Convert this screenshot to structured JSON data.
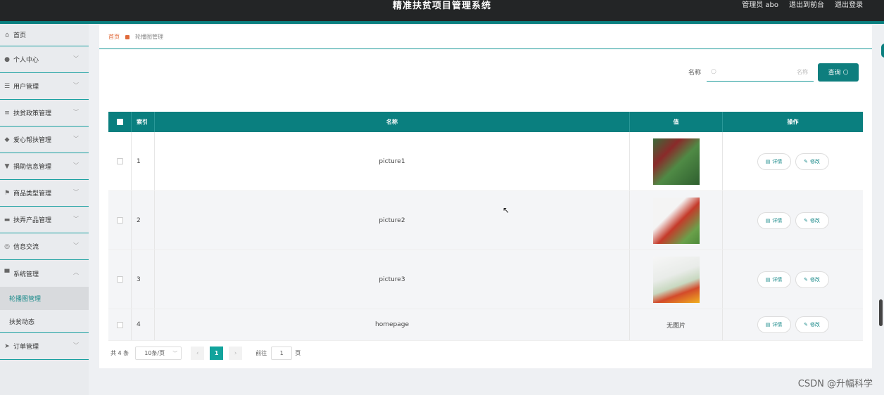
{
  "header": {
    "title": "精准扶贫项目管理系统",
    "user": "管理员 abo",
    "back_front": "退出到前台",
    "logout": "退出登录"
  },
  "sidebar": {
    "items": [
      {
        "label": "首页",
        "icon": "home-icon"
      },
      {
        "label": "个人中心",
        "icon": "person-icon"
      },
      {
        "label": "用户管理",
        "icon": "sliders-icon"
      },
      {
        "label": "扶贫政策管理",
        "icon": "list-icon"
      },
      {
        "label": "爱心帮扶管理",
        "icon": "pin-icon"
      },
      {
        "label": "捐助信息管理",
        "icon": "chat-icon"
      },
      {
        "label": "商品类型管理",
        "icon": "flag-icon"
      },
      {
        "label": "扶弄产品管理",
        "icon": "box-icon"
      },
      {
        "label": "信息交流",
        "icon": "compass-icon"
      },
      {
        "label": "系统管理",
        "icon": "monitor-icon"
      }
    ],
    "subitems": [
      {
        "label": "轮播图管理",
        "active": true
      },
      {
        "label": "扶贫动态",
        "active": false
      }
    ],
    "last_item": {
      "label": "订单管理",
      "icon": "send-icon"
    }
  },
  "breadcrumb": {
    "home": "首页",
    "current": "轮播图管理"
  },
  "search": {
    "label": "名称",
    "placeholder": "名称",
    "button": "查询"
  },
  "table": {
    "headers": {
      "index": "索引",
      "name": "名称",
      "value": "值",
      "action": "操作"
    },
    "rows": [
      {
        "index": "1",
        "name": "picture1",
        "value": ""
      },
      {
        "index": "2",
        "name": "picture2",
        "value": ""
      },
      {
        "index": "3",
        "name": "picture3",
        "value": ""
      },
      {
        "index": "4",
        "name": "homepage",
        "value": "无图片"
      }
    ],
    "detail_label": "详情",
    "edit_label": "修改"
  },
  "pager": {
    "total": "共 4 条",
    "page_size": "10条/页",
    "current_page": "1",
    "goto_label": "前往",
    "goto_value": "1",
    "page_suffix": "页"
  },
  "watermark": "CSDN @升幅科学"
}
